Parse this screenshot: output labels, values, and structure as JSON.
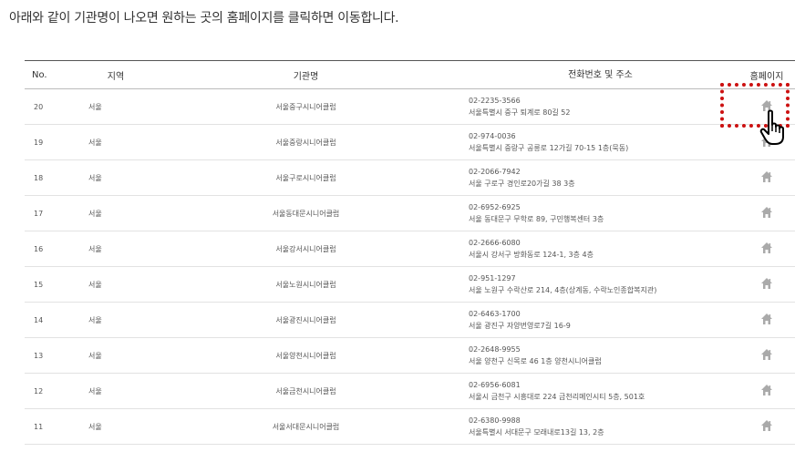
{
  "intro_text": "아래와 같이 기관명이 나오면 원하는 곳의 홈페이지를 클릭하면 이동합니다.",
  "table": {
    "headers": {
      "no": "No.",
      "region": "지역",
      "name": "기관명",
      "contact": "전화번호 및 주소",
      "home": "홈페이지"
    },
    "rows": [
      {
        "no": "20",
        "region": "서울",
        "name": "서울중구시니어클럽",
        "phone": "02-2235-3566",
        "address": "서울특별시 중구 퇴계로 80길 52"
      },
      {
        "no": "19",
        "region": "서울",
        "name": "서울중랑시니어클럽",
        "phone": "02-974-0036",
        "address": "서울특별시 중랑구 공릉로 12가길 70-15 1층(묵동)"
      },
      {
        "no": "18",
        "region": "서울",
        "name": "서울구로시니어클럽",
        "phone": "02-2066-7942",
        "address": "서울 구로구 경인로20가길 38 3층"
      },
      {
        "no": "17",
        "region": "서울",
        "name": "서울동대문시니어클럽",
        "phone": "02-6952-6925",
        "address": "서울 동대문구 무학로 89, 구민행복센터 3층"
      },
      {
        "no": "16",
        "region": "서울",
        "name": "서울강서시니어클럽",
        "phone": "02-2666-6080",
        "address": "서울시 강서구 방화동로 124-1, 3층 4층"
      },
      {
        "no": "15",
        "region": "서울",
        "name": "서울노원시니어클럽",
        "phone": "02-951-1297",
        "address": "서울 노원구 수락산로 214, 4층(상계동, 수락노인종합복지관)"
      },
      {
        "no": "14",
        "region": "서울",
        "name": "서울광진시니어클럽",
        "phone": "02-6463-1700",
        "address": "서울 광진구 자양번영로7길 16-9"
      },
      {
        "no": "13",
        "region": "서울",
        "name": "서울양천시니어클럽",
        "phone": "02-2648-9955",
        "address": "서울 양천구 신목로 46 1층 양천시니어클럽"
      },
      {
        "no": "12",
        "region": "서울",
        "name": "서울금천시니어클럽",
        "phone": "02-6956-6081",
        "address": "서울시 금천구 시흥대로 224 금천리메인시티 5층, 501호"
      },
      {
        "no": "11",
        "region": "서울",
        "name": "서울서대문시니어클럽",
        "phone": "02-6380-9988",
        "address": "서울특별시 서대문구 모래내로13길 13, 2층"
      }
    ]
  },
  "colors": {
    "highlight": "#cc1111",
    "home_icon": "#aaaaaa"
  },
  "icons": {
    "home": "home-icon",
    "cursor": "pointing-hand-cursor-icon"
  }
}
